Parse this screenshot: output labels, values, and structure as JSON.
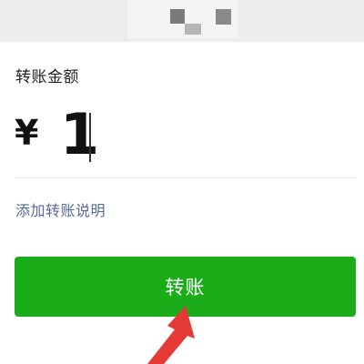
{
  "form": {
    "amount_label": "转账金额",
    "currency_symbol": "¥",
    "amount_value": "1",
    "add_note_link": "添加转账说明"
  },
  "actions": {
    "transfer_button_label": "转账"
  },
  "icons": {
    "recipient_avatar": "pixelated-avatar-icon",
    "pointer": "red-arrow-icon"
  },
  "colors": {
    "primary_button": "#1aad19",
    "link": "#576b95",
    "annotation_arrow": "#e53935"
  }
}
